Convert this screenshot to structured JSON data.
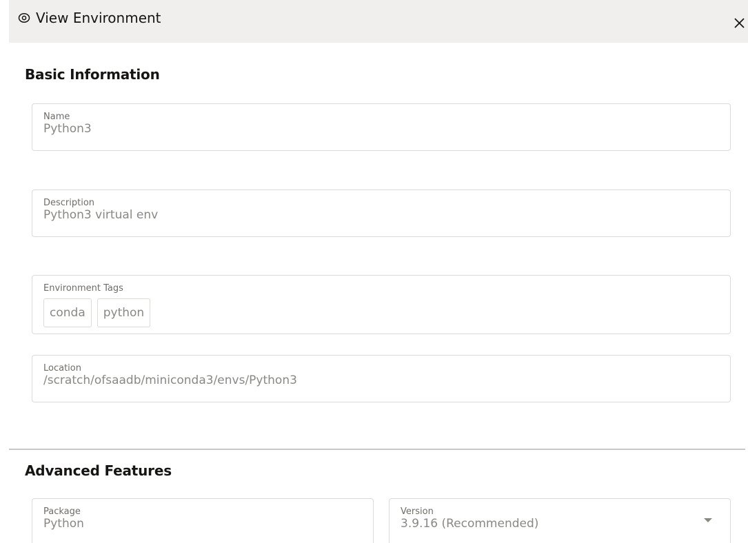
{
  "header": {
    "title": "View Environment",
    "icon": "eye-icon",
    "close_icon": "close-icon"
  },
  "basic": {
    "title": "Basic Information",
    "name": {
      "label": "Name",
      "value": "Python3"
    },
    "description": {
      "label": "Description",
      "value": "Python3 virtual env"
    },
    "tags": {
      "label": "Environment Tags",
      "items": [
        "conda",
        "python"
      ]
    },
    "location": {
      "label": "Location",
      "value": "/scratch/ofsaadb/miniconda3/envs/Python3"
    }
  },
  "advanced": {
    "title": "Advanced Features",
    "package": {
      "label": "Package",
      "value": "Python"
    },
    "version": {
      "label": "Version",
      "value": "3.9.16 (Recommended)"
    }
  },
  "colors": {
    "header_bg": "#f1efed",
    "border": "#dcdad6",
    "value_text": "#8a8885",
    "label_text": "#6f6c68"
  }
}
